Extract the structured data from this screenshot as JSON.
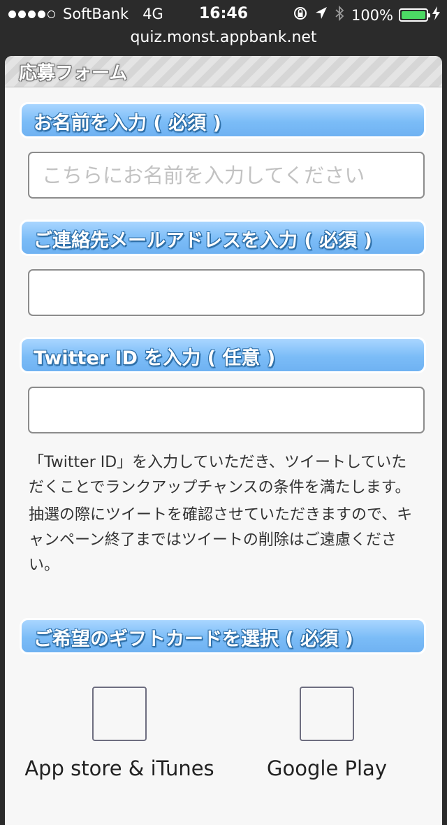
{
  "status_bar": {
    "carrier": "SoftBank",
    "network": "4G",
    "time": "16:46",
    "battery": "100%"
  },
  "browser": {
    "url": "quiz.monst.appbank.net"
  },
  "form": {
    "title": "応募フォーム",
    "name_section_label": "お名前を入力 ( 必須 )",
    "name_placeholder": "こちらにお名前を入力してください",
    "email_section_label": "ご連絡先メールアドレスを入力 ( 必須 )",
    "email_value": "",
    "twitter_section_label": "Twitter ID を入力 ( 任意 )",
    "twitter_value": "",
    "notes": [
      "「Twitter ID」を入力していただき、ツイートしていただくことでランクアップチャンスの条件を満たします。",
      "抽選の際にツイートを確認させていただきますので、キャンペーン終了まではツイートの削除はご遠慮ください。"
    ],
    "gift_section_label": "ご希望のギフトカードを選択 ( 必須 )",
    "gift_options": [
      {
        "label": "App store & iTunes"
      },
      {
        "label": "Google Play"
      }
    ]
  },
  "colors": {
    "section_blue": "#7bbcf7",
    "battery_green": "#4cd964",
    "bar_background": "#2b2b2b",
    "card_background": "#f7f7f7"
  },
  "icons": [
    "signal-dots-icon",
    "orientation-lock-icon",
    "location-arrow-icon",
    "bluetooth-icon",
    "battery-icon",
    "charging-bolt-icon"
  ]
}
